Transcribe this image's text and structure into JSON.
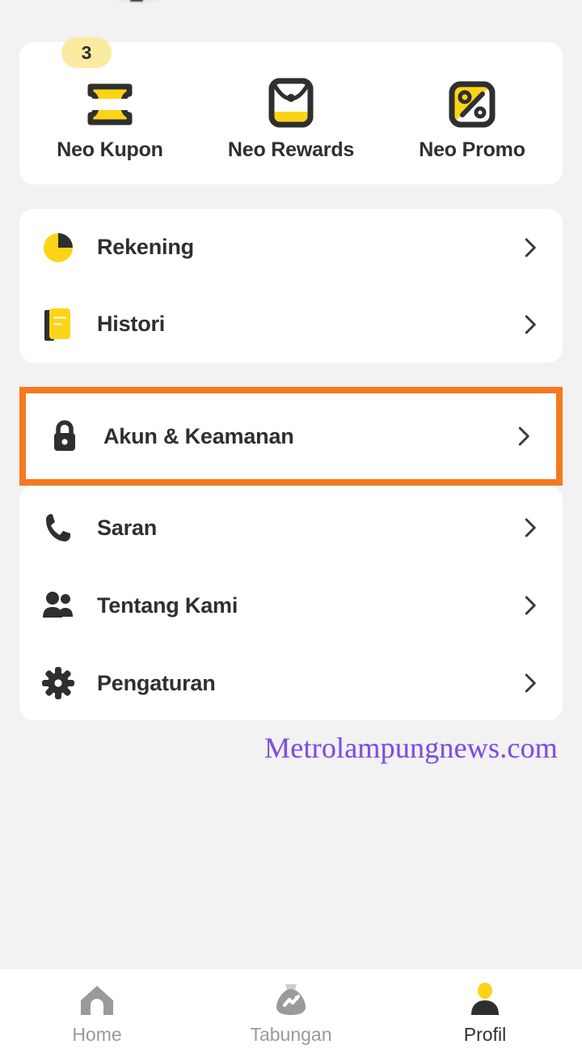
{
  "app": {
    "background_color": "#f2f2f2",
    "card_color": "#ffffff",
    "accent_yellow": "#fbd417",
    "badge_yellow": "#faeba1",
    "highlight_orange": "#f4791f",
    "text_dark": "#2f2f2f",
    "text_muted": "#9a9a9a",
    "watermark_purple": "#7c4ee0"
  },
  "quick_actions": {
    "items": [
      {
        "label": "Neo Kupon",
        "icon": "coupon-ticket-icon",
        "badge": "3"
      },
      {
        "label": "Neo Rewards",
        "icon": "reward-pouch-icon",
        "badge": ""
      },
      {
        "label": "Neo Promo",
        "icon": "percent-tag-icon",
        "badge": ""
      }
    ]
  },
  "menu_group_1": {
    "items": [
      {
        "label": "Rekening",
        "icon": "pie-chart-icon",
        "chevron": "chevron-right-icon"
      },
      {
        "label": "Histori",
        "icon": "book-icon",
        "chevron": "chevron-right-icon"
      }
    ]
  },
  "highlighted_item": {
    "label": "Akun & Keamanan",
    "icon": "lock-icon",
    "chevron": "chevron-right-icon",
    "highlight_color": "#f4791f"
  },
  "menu_group_2": {
    "items": [
      {
        "label": "Saran",
        "icon": "phone-icon",
        "chevron": "chevron-right-icon"
      },
      {
        "label": "Tentang Kami",
        "icon": "people-icon",
        "chevron": "chevron-right-icon"
      },
      {
        "label": "Pengaturan",
        "icon": "gear-icon",
        "chevron": "chevron-right-icon"
      }
    ]
  },
  "watermark": {
    "text": "Metrolampungnews.com"
  },
  "bottom_nav": {
    "items": [
      {
        "label": "Home",
        "icon": "home-icon",
        "active": false
      },
      {
        "label": "Tabungan",
        "icon": "money-bag-icon",
        "active": false
      },
      {
        "label": "Profil",
        "icon": "person-icon",
        "active": true
      }
    ]
  }
}
